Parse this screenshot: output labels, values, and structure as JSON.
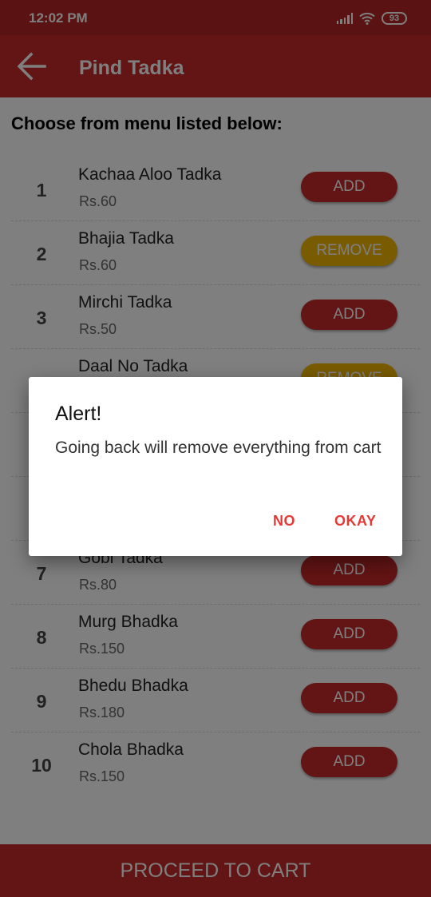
{
  "status_bar": {
    "time": "12:02 PM",
    "battery": "93"
  },
  "app_bar": {
    "title": "Pind Tadka",
    "back_icon": "arrow-left-icon"
  },
  "content": {
    "heading": "Choose from menu listed below:"
  },
  "menu": [
    {
      "num": "1",
      "name": "Kachaa Aloo Tadka",
      "price": "Rs.60",
      "button": "ADD"
    },
    {
      "num": "2",
      "name": "Bhajia Tadka",
      "price": "Rs.60",
      "button": "REMOVE"
    },
    {
      "num": "3",
      "name": "Mirchi Tadka",
      "price": "Rs.50",
      "button": "ADD"
    },
    {
      "num": "",
      "name": "Daal No Tadka",
      "price": "",
      "button": "REMOVE"
    },
    {
      "num": "",
      "name": "",
      "price": "",
      "button": ""
    },
    {
      "num": "",
      "name": "",
      "price": "",
      "button": ""
    },
    {
      "num": "7",
      "name": "Gobi Tadka",
      "price": "Rs.80",
      "button": "ADD"
    },
    {
      "num": "8",
      "name": "Murg Bhadka",
      "price": "Rs.150",
      "button": "ADD"
    },
    {
      "num": "9",
      "name": "Bhedu Bhadka",
      "price": "Rs.180",
      "button": "ADD"
    },
    {
      "num": "10",
      "name": "Chola Bhadka",
      "price": "Rs.150",
      "button": "ADD"
    }
  ],
  "footer": {
    "proceed_label": "PROCEED TO CART"
  },
  "dialog": {
    "title": "Alert!",
    "message": "Going back will remove everything from cart",
    "negative_label": "NO",
    "positive_label": "OKAY"
  },
  "colors": {
    "primary": "#c62828",
    "status_bar": "#b52424",
    "remove_button": "#f2b705",
    "dialog_action": "#e53935"
  }
}
